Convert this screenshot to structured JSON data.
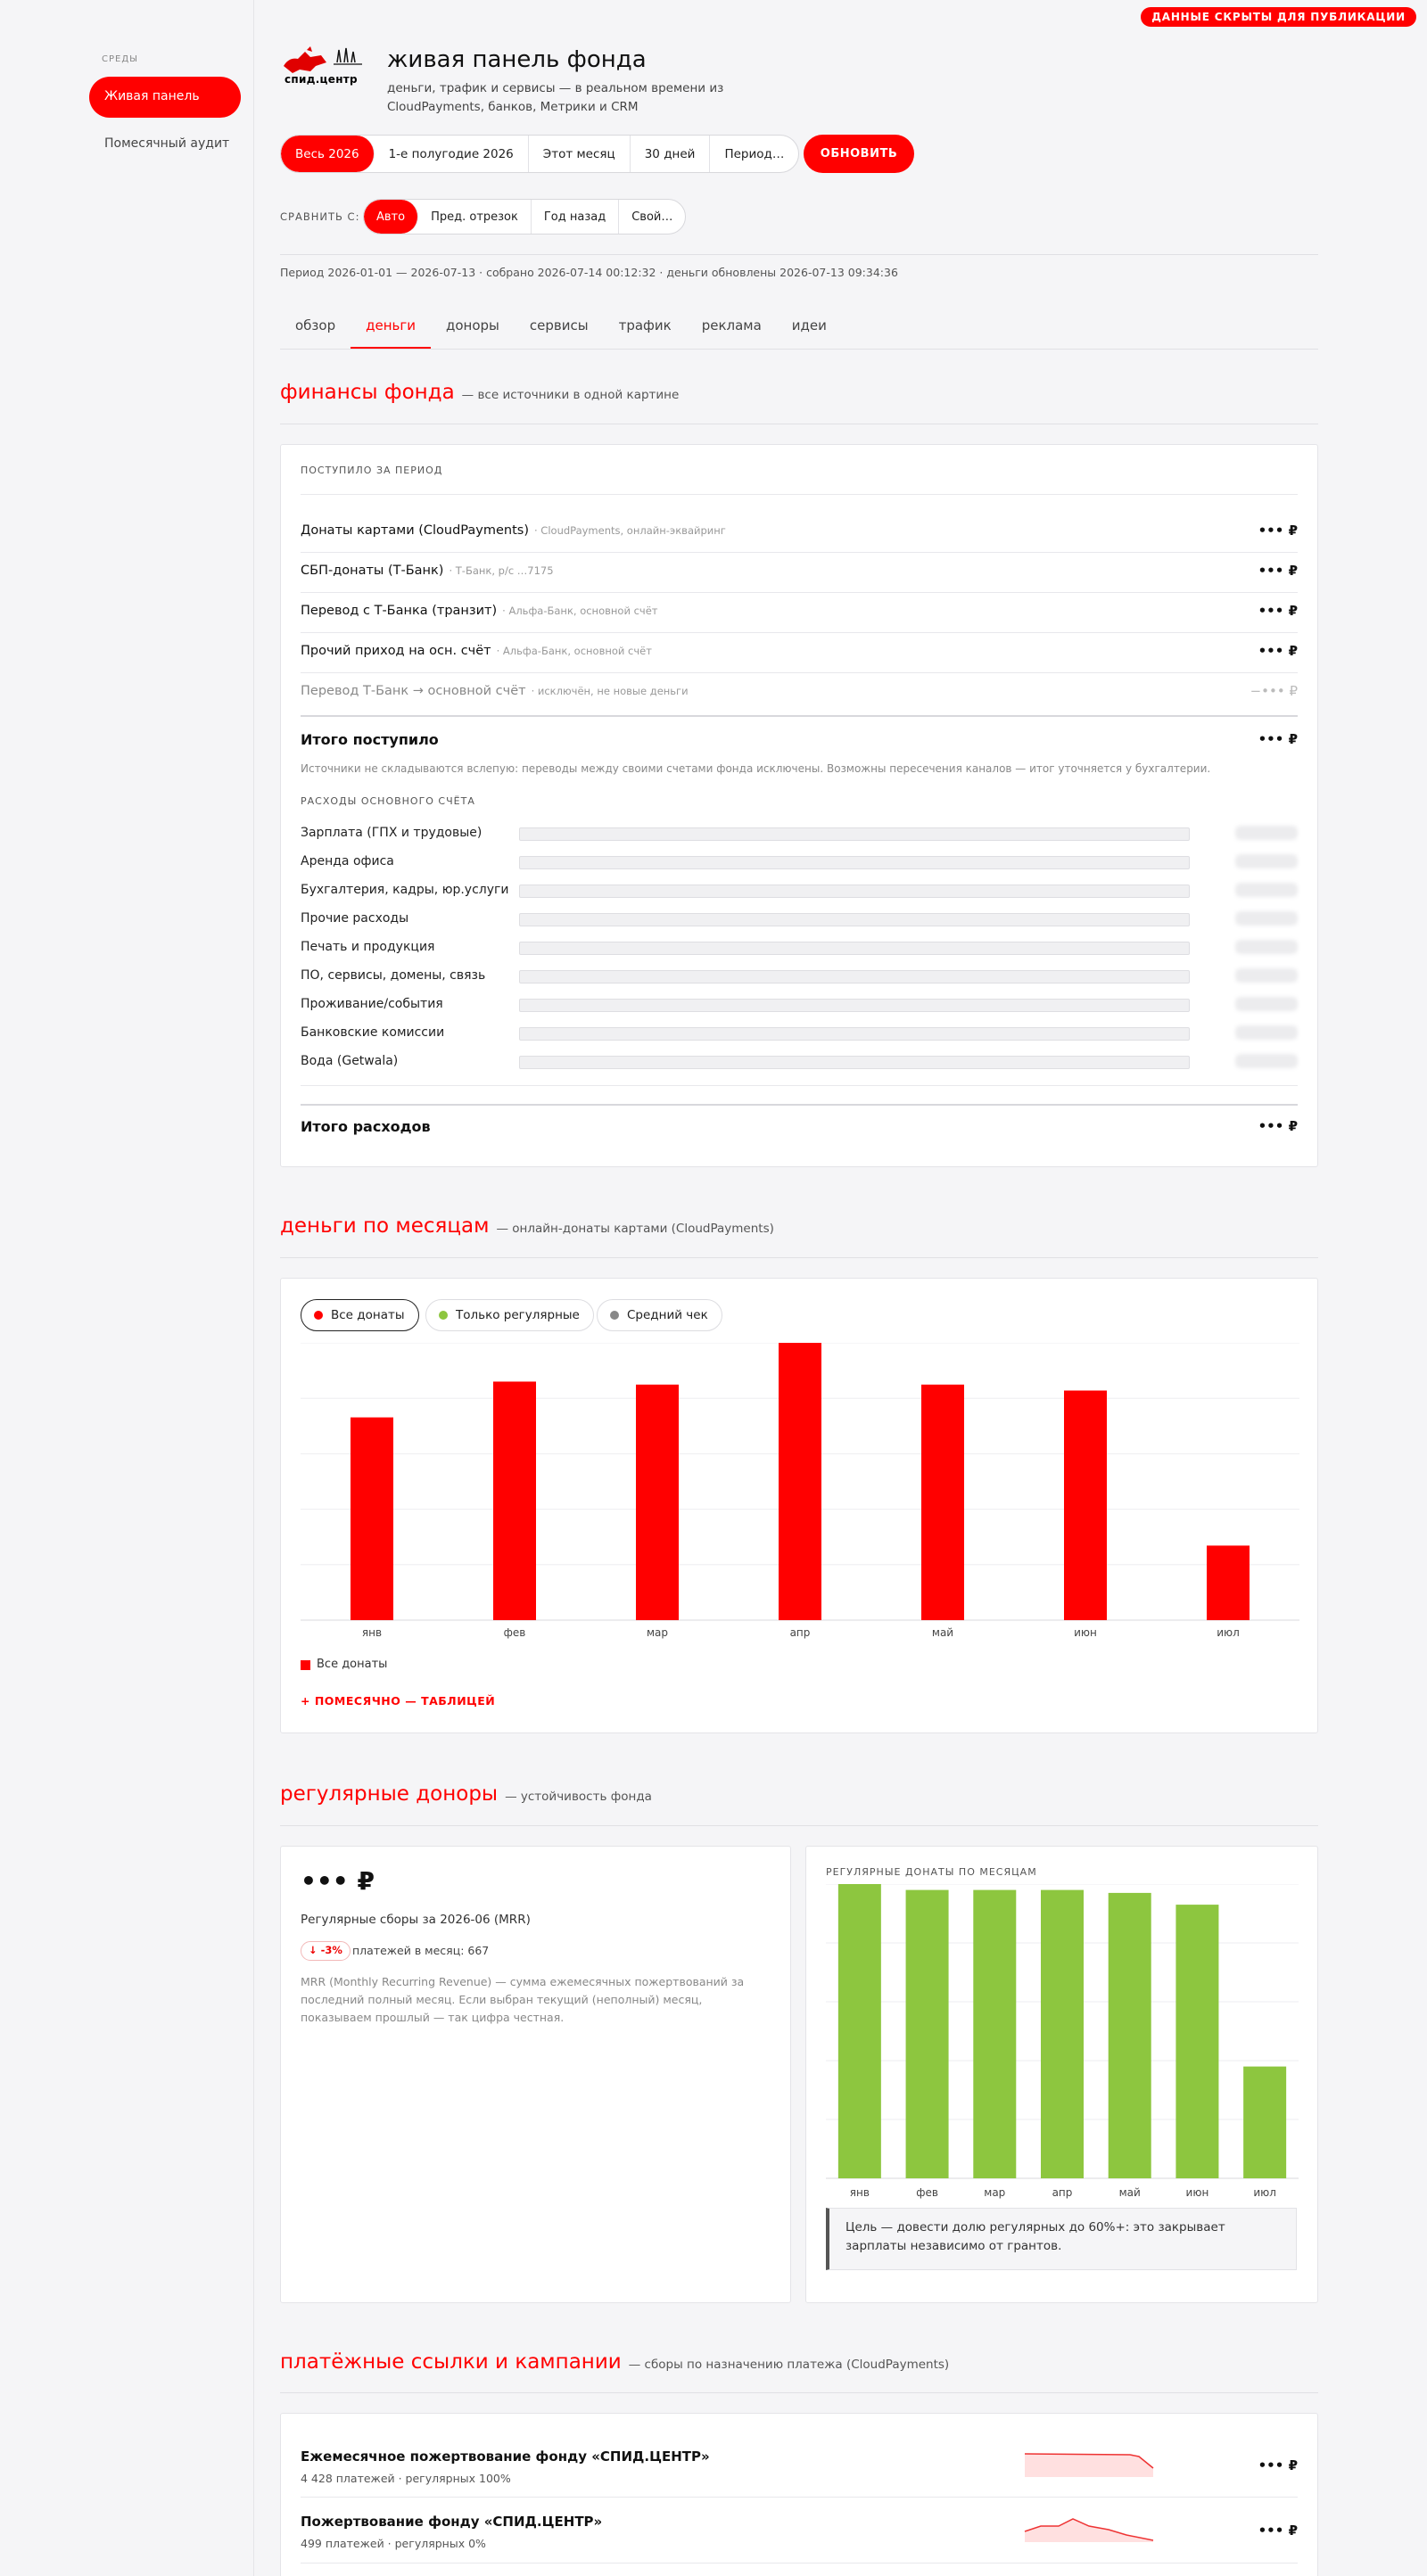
{
  "badge": "ДАННЫЕ СКРЫТЫ ДЛЯ ПУБЛИКАЦИИ",
  "sidebar": {
    "heading": "СРЕДЫ",
    "items": [
      {
        "label": "Живая панель"
      },
      {
        "label": "Помесячный аудит"
      }
    ]
  },
  "header": {
    "logo_text": "спид.центр",
    "title": "живая панель фонда",
    "subtitle": "деньги, трафик и сервисы — в реальном времени из CloudPayments, банков, Метрики и CRM"
  },
  "period": {
    "options": [
      "Весь 2026",
      "1-е полугодие 2026",
      "Этот месяц",
      "30 дней",
      "Период…"
    ],
    "selected": "Весь 2026",
    "refresh_label": "ОБНОВИТЬ"
  },
  "compare": {
    "label": "СРАВНИТЬ С:",
    "options": [
      "Авто",
      "Пред. отрезок",
      "Год назад",
      "Свой…"
    ],
    "selected": "Авто"
  },
  "meta": "Период 2026-01-01 — 2026-07-13 · собрано 2026-07-14 00:12:32 · деньги обновлены 2026-07-13 09:34:36",
  "tabs": [
    "обзор",
    "деньги",
    "доноры",
    "сервисы",
    "трафик",
    "реклама",
    "идеи"
  ],
  "active_tab": "деньги",
  "finance": {
    "title": "финансы фонда",
    "note": "— все источники в одной картине",
    "income_heading": "ПОСТУПИЛО ЗА ПЕРИОД",
    "income": [
      {
        "label": "Донаты картами (CloudPayments)",
        "source": "· CloudPayments, онлайн-эквайринг",
        "value": "••• ₽"
      },
      {
        "label": "СБП-донаты (Т-Банк)",
        "source": "· Т-Банк, р/с …7175",
        "value": "••• ₽"
      },
      {
        "label": "Перевод с Т-Банка (транзит)",
        "source": "· Альфа-Банк, основной счёт",
        "value": "••• ₽"
      },
      {
        "label": "Прочий приход на осн. счёт",
        "source": "· Альфа-Банк, основной счёт",
        "value": "••• ₽"
      },
      {
        "label": "Перевод Т-Банк → основной счёт",
        "source": "· исключён, не новые деньги",
        "value": "−••• ₽"
      }
    ],
    "total_income": {
      "label": "Итого поступило",
      "value": "••• ₽"
    },
    "disclaimer": "Источники не складываются вслепую: переводы между своими счетами фонда исключены. Возможны пересечения каналов — итог уточняется у бухгалтерии.",
    "expenses_heading": "РАСХОДЫ ОСНОВНОГО СЧЁТА",
    "expenses": [
      {
        "label": "Зарплата (ГПХ и трудовые)"
      },
      {
        "label": "Аренда офиса"
      },
      {
        "label": "Бухгалтерия, кадры, юр.услуги"
      },
      {
        "label": "Прочие расходы"
      },
      {
        "label": "Печать и продукция"
      },
      {
        "label": "ПО, сервисы, домены, связь"
      },
      {
        "label": "Проживание/события"
      },
      {
        "label": "Банковские комиссии"
      },
      {
        "label": "Вода (Getwala)"
      }
    ],
    "total_expenses": {
      "label": "Итого расходов",
      "value": "••• ₽"
    }
  },
  "monthly": {
    "title": "деньги по месяцам",
    "note": "— онлайн-донаты картами (CloudPayments)",
    "pills": [
      {
        "label": "Все донаты",
        "color": "#ff0000"
      },
      {
        "label": "Только регулярные",
        "color": "#8dc63f"
      },
      {
        "label": "Средний чек",
        "color": "#888888"
      }
    ],
    "legend": "Все донаты",
    "table_link": "+ ПОМЕСЯЧНО — ТАБЛИЦЕЙ"
  },
  "regular": {
    "title": "регулярные доноры",
    "note": "— устойчивость фонда",
    "mrr_value": "••• ₽",
    "mrr_label": "Регулярные сборы за 2026-06 (MRR)",
    "delta": "↓ -3%",
    "payments": "платежей в месяц: 667",
    "description": "MRR (Monthly Recurring Revenue) — сумма ежемесячных пожертвований за последний полный месяц. Если выбран текущий (неполный) месяц, показываем прошлый — так цифра честная.",
    "chart_heading": "РЕГУЛЯРНЫЕ ДОНАТЫ ПО МЕСЯЦАМ",
    "goal": "Цель — довести долю регулярных до 60%+: это закрывает зарплаты независимо от грантов."
  },
  "links": {
    "title": "платёжные ссылки и кампании",
    "note": "— сборы по назначению платежа (CloudPayments)",
    "items": [
      {
        "title": "Ежемесячное пожертвование фонду «СПИД.ЦЕНТР»",
        "sub": "4 428 платежей · регулярных 100%",
        "value": "••• ₽"
      },
      {
        "title": "Пожертвование фонду «СПИД.ЦЕНТР»",
        "sub": "499 платежей · регулярных 0%",
        "value": "••• ₽"
      }
    ]
  },
  "chart_data": [
    {
      "type": "bar",
      "categories": [
        "янв",
        "фев",
        "мар",
        "апр",
        "май",
        "июн",
        "июл"
      ],
      "values": [
        68,
        80,
        79,
        93,
        79,
        77,
        25
      ],
      "series": [
        {
          "name": "Все донаты",
          "values": [
            68,
            80,
            79,
            93,
            79,
            77,
            25
          ]
        }
      ],
      "color": "#ff0000",
      "grid": true,
      "legend": "bottom-left"
    },
    {
      "type": "bar",
      "title": "РЕГУЛЯРНЫЕ ДОНАТЫ ПО МЕСЯЦАМ",
      "categories": [
        "янв",
        "фев",
        "мар",
        "апр",
        "май",
        "июн",
        "июл"
      ],
      "values": [
        100,
        98,
        98,
        98,
        97,
        93,
        38
      ],
      "color": "#8dc63f",
      "grid": true
    }
  ]
}
